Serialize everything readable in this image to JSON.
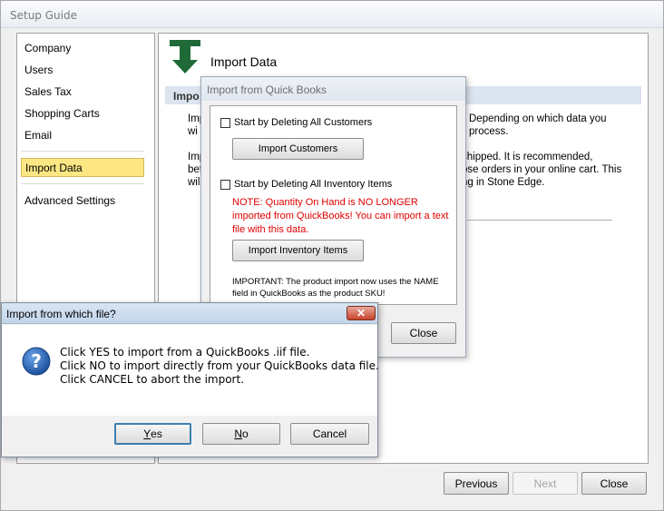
{
  "main_window": {
    "title": "Setup Guide",
    "sidebar": {
      "items": [
        "Company",
        "Users",
        "Sales Tax",
        "Shopping Carts",
        "Email"
      ],
      "selected": "Import Data",
      "advanced": "Advanced Settings"
    },
    "content": {
      "title": "Import Data",
      "band_text": "Impo",
      "para1": [
        "Impo",
        "wi"
      ],
      "para1_right": [
        "Depending on which data you",
        "process."
      ],
      "para2": [
        "Impo",
        "bef",
        "wil"
      ],
      "para2_right": [
        "shipped.  It is recommended,",
        "ose orders in your online cart.  This",
        "ng in Stone Edge."
      ]
    },
    "footer": {
      "previous": "Previous",
      "next": "Next",
      "close": "Close"
    }
  },
  "qb_dialog": {
    "title": "Import from Quick Books",
    "delete_customers_label": "Start by Deleting All Customers",
    "import_customers_button": "Import Customers",
    "delete_inventory_label": "Start by Deleting All Inventory Items",
    "warning_note": "NOTE: Quantity On Hand is NO LONGER imported from QuickBooks! You can import a text file with this data.",
    "import_inventory_button": "Import Inventory Items",
    "important_note": "IMPORTANT: The product import now uses the NAME field in QuickBooks as the product SKU!",
    "close_button": "Close"
  },
  "file_dialog": {
    "title": "Import from which file?",
    "close_glyph": "✕",
    "messages": [
      "Click YES to import from a QuickBooks .iif file.",
      "Click NO to import directly from your QuickBooks data file.",
      "Click CANCEL to abort the import."
    ],
    "yes_mnemonic": "Y",
    "yes_rest": "es",
    "no_mnemonic": "N",
    "no_rest": "o",
    "cancel_button": "Cancel"
  },
  "colors": {
    "selected_item_bg": "#fce784",
    "warning_text": "#e00000",
    "band_bg": "#dce4f0",
    "question_icon": "#2c6fc4",
    "arrow_icon": "#1f6a36"
  },
  "icons": [
    "download-arrow-icon",
    "question-icon",
    "close-icon"
  ]
}
